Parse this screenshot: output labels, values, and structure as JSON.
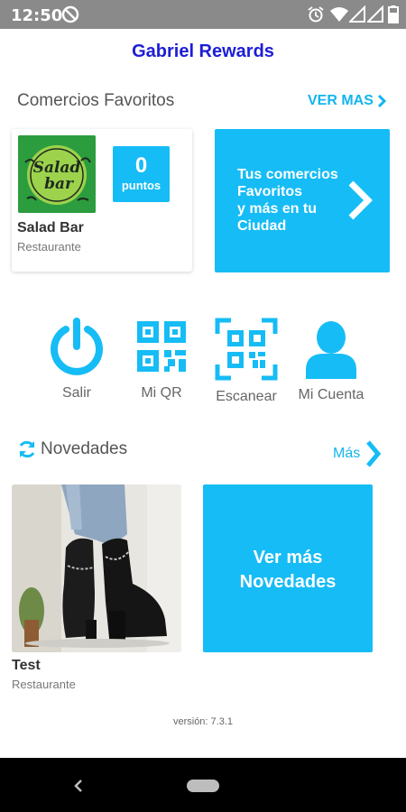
{
  "status_bar": {
    "time": "12:50"
  },
  "app": {
    "title": "Gabriel Rewards"
  },
  "favorites": {
    "section_title": "Comercios Favoritos",
    "see_more": "VER MAS",
    "card": {
      "logo_text_1": "Salad",
      "logo_text_2": "bar",
      "points_value": "0",
      "points_label": "puntos",
      "name": "Salad Bar",
      "category": "Restaurante"
    },
    "promo": {
      "line1": "Tus comercios",
      "line2": "Favoritos",
      "line3": "y más en tu",
      "line4": "Ciudad"
    }
  },
  "actions": [
    {
      "label": "Salir",
      "icon": "power-icon"
    },
    {
      "label": "Mi QR",
      "icon": "qr-code-icon"
    },
    {
      "label": "Escanear",
      "icon": "scan-icon"
    },
    {
      "label": "Mi Cuenta",
      "icon": "user-icon"
    }
  ],
  "news": {
    "section_title": "Novedades",
    "more_link": "Más",
    "item": {
      "name": "Test",
      "category": "Restaurante"
    },
    "more_card": {
      "line1": "Ver más",
      "line2": "Novedades"
    }
  },
  "footer": {
    "version": "versión: 7.3.1"
  },
  "colors": {
    "accent": "#16bcf5",
    "title": "#1d1dd6",
    "link": "#13b5ee"
  }
}
